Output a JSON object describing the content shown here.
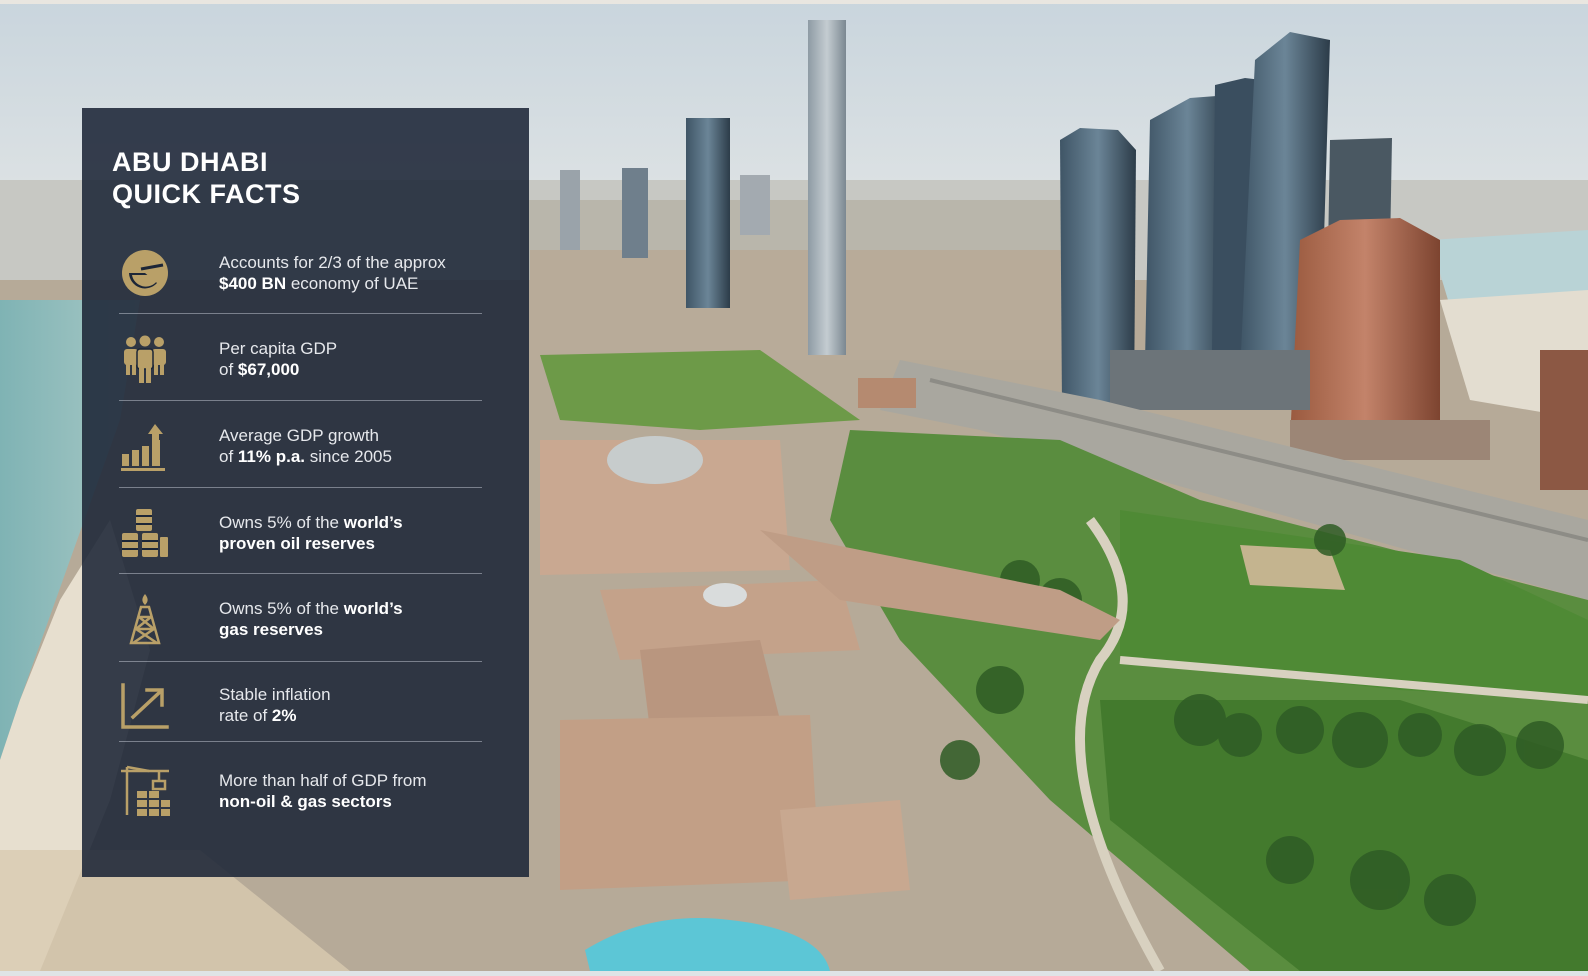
{
  "panel": {
    "title_line1": "ABU DHABI",
    "title_line2": "QUICK FACTS",
    "icon_color": "#b9a068",
    "facts": [
      {
        "icon": "pie-chart-icon",
        "line1_pre": "Accounts for 2/3 of the approx",
        "line2_bold": "$400 BN",
        "line2_post": " economy of UAE"
      },
      {
        "icon": "people-group-icon",
        "line1_pre": "Per capita GDP",
        "line2_pre": "of ",
        "line2_bold": "$67,000"
      },
      {
        "icon": "bar-chart-growth-icon",
        "line1_pre": "Average GDP growth",
        "line2_pre": "of ",
        "line2_bold": "11% p.a.",
        "line2_post": " since 2005"
      },
      {
        "icon": "oil-barrels-icon",
        "line1_pre": "Owns 5% of the ",
        "line1_bold": "world’s",
        "line2_bold": "proven oil reserves"
      },
      {
        "icon": "gas-rig-icon",
        "line1_pre": "Owns 5% of the ",
        "line1_bold": "world’s",
        "line2_bold": "gas reserves"
      },
      {
        "icon": "trend-arrow-icon",
        "line1_pre": "Stable inflation",
        "line2_pre": "rate of ",
        "line2_bold": "2%"
      },
      {
        "icon": "crane-blocks-icon",
        "line1_pre": "More than half of GDP from",
        "line2_bold": "non-oil & gas sectors"
      }
    ]
  }
}
